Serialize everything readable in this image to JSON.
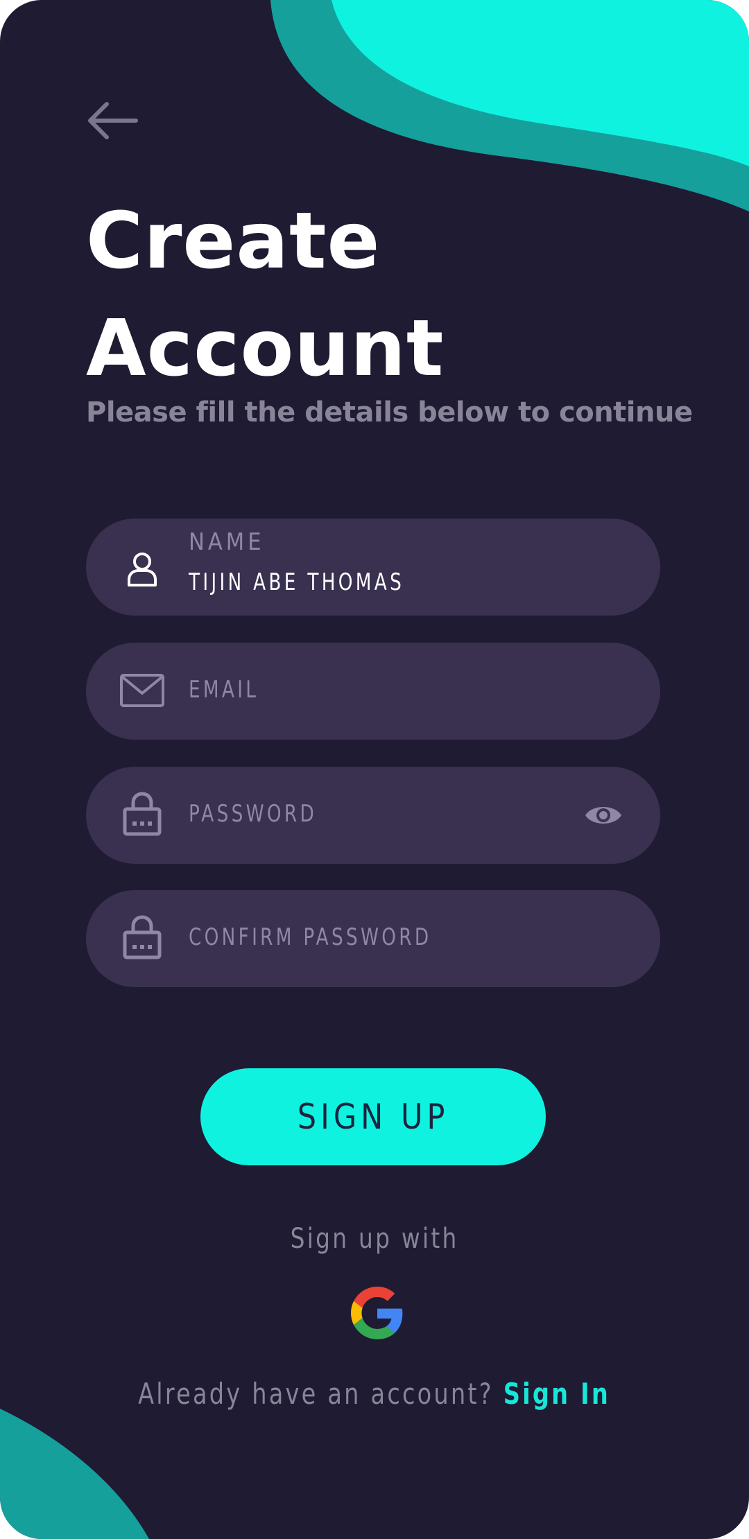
{
  "header": {
    "back_icon": "arrow-left-icon",
    "title_line1": "Create",
    "title_line2": "Account",
    "subtitle": "Please fill the details below to continue"
  },
  "form": {
    "name": {
      "label": "NAME",
      "value": "TIJIN ABE THOMAS",
      "icon": "user-icon"
    },
    "email": {
      "placeholder": "EMAIL",
      "icon": "mail-icon"
    },
    "password": {
      "placeholder": "PASSWORD",
      "icon": "lock-icon",
      "toggle_icon": "eye-icon"
    },
    "confirm_password": {
      "placeholder": "CONFIRM PASSWORD",
      "icon": "lock-icon"
    }
  },
  "actions": {
    "signup_label": "SIGN UP",
    "signup_with": "Sign up with",
    "social_icon": "google-icon"
  },
  "footer": {
    "prompt": "Already have an account?",
    "link": "Sign In"
  },
  "colors": {
    "background": "#1f1b32",
    "field": "#3a3150",
    "accent": "#10f2e0",
    "accent_dark": "#16a09c",
    "muted_text": "#8a8499"
  }
}
